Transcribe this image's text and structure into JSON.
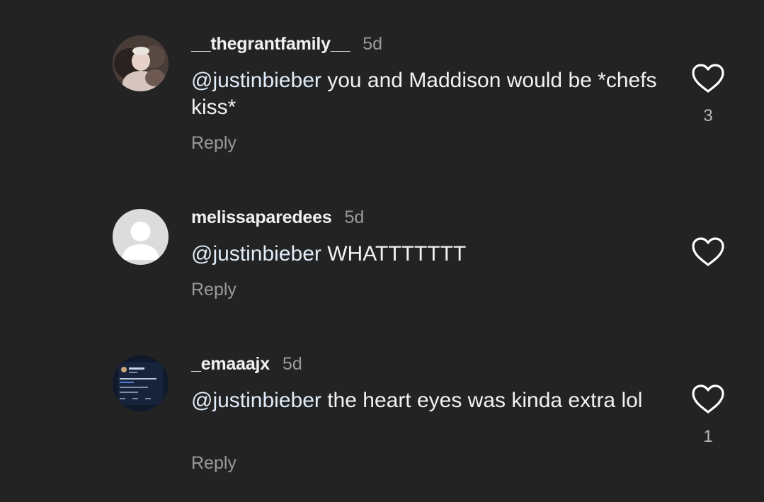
{
  "comments": [
    {
      "username": "__thegrantfamily__",
      "time": "5d",
      "mention": "@justinbieber",
      "text": " you and Maddison would be *chefs kiss*",
      "reply_label": "Reply",
      "likes": "3"
    },
    {
      "username": "melissaparedees",
      "time": "5d",
      "mention": "@justinbieber",
      "text": " WHATTTTTTT",
      "reply_label": "Reply",
      "likes": ""
    },
    {
      "username": "_emaaajx",
      "time": "5d",
      "mention": "@justinbieber",
      "text": " the heart eyes was kinda extra lol",
      "reply_label": "Reply",
      "likes": "1"
    }
  ],
  "icons": {
    "like": "heart-outline-icon",
    "default_avatar": "person-icon"
  },
  "colors": {
    "background": "#232323",
    "text": "#f2f2f2",
    "secondary": "#9a9a9a",
    "mention": "#e0ecf8"
  }
}
